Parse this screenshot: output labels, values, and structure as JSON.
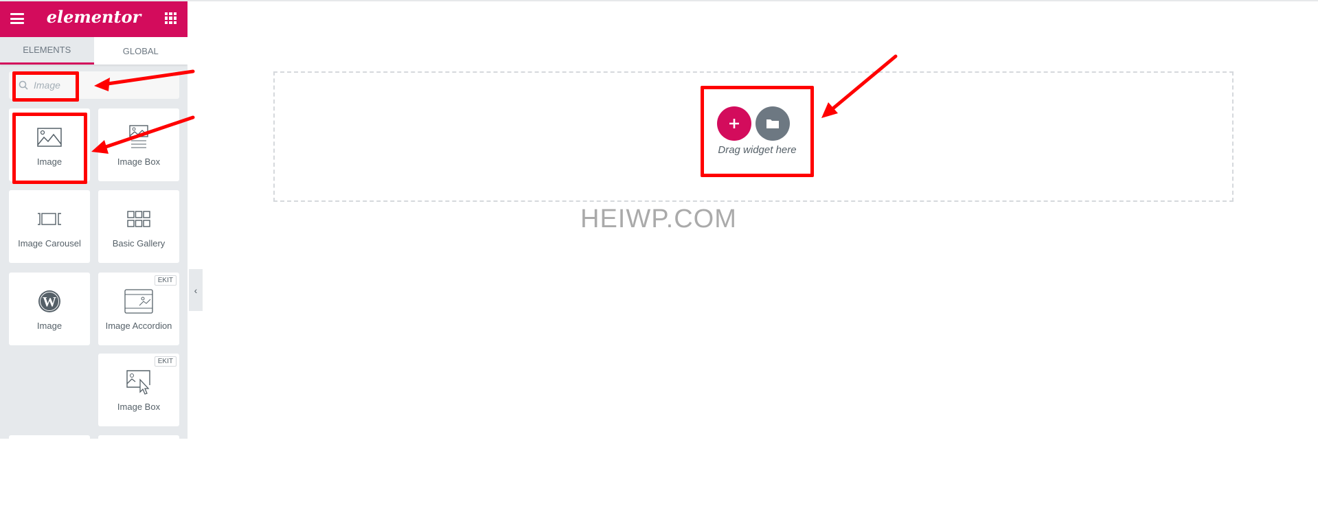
{
  "panel": {
    "logo": "elementor",
    "tabs": [
      {
        "label": "ELEMENTS",
        "active": true
      },
      {
        "label": "GLOBAL",
        "active": false
      }
    ],
    "search": {
      "value": "Image"
    },
    "widgets": [
      {
        "label": "Image",
        "icon": "image-icon"
      },
      {
        "label": "Image Box",
        "icon": "image-box-icon"
      },
      {
        "label": "Image Carousel",
        "icon": "carousel-icon"
      },
      {
        "label": "Basic Gallery",
        "icon": "gallery-icon"
      },
      {
        "label": "Image",
        "icon": "wordpress-icon"
      },
      {
        "label": "Image Accordion",
        "icon": "accordion-icon",
        "badge": "EKIT"
      },
      {
        "label": "Image Box",
        "icon": "image-box-cursor-icon",
        "badge": "EKIT"
      }
    ]
  },
  "canvas": {
    "drag_text": "Drag widget here",
    "watermark": "HEIWP.COM"
  },
  "colors": {
    "brand": "#d30c5c",
    "annotation": "#ff0000",
    "folder_button": "#6d7882"
  }
}
